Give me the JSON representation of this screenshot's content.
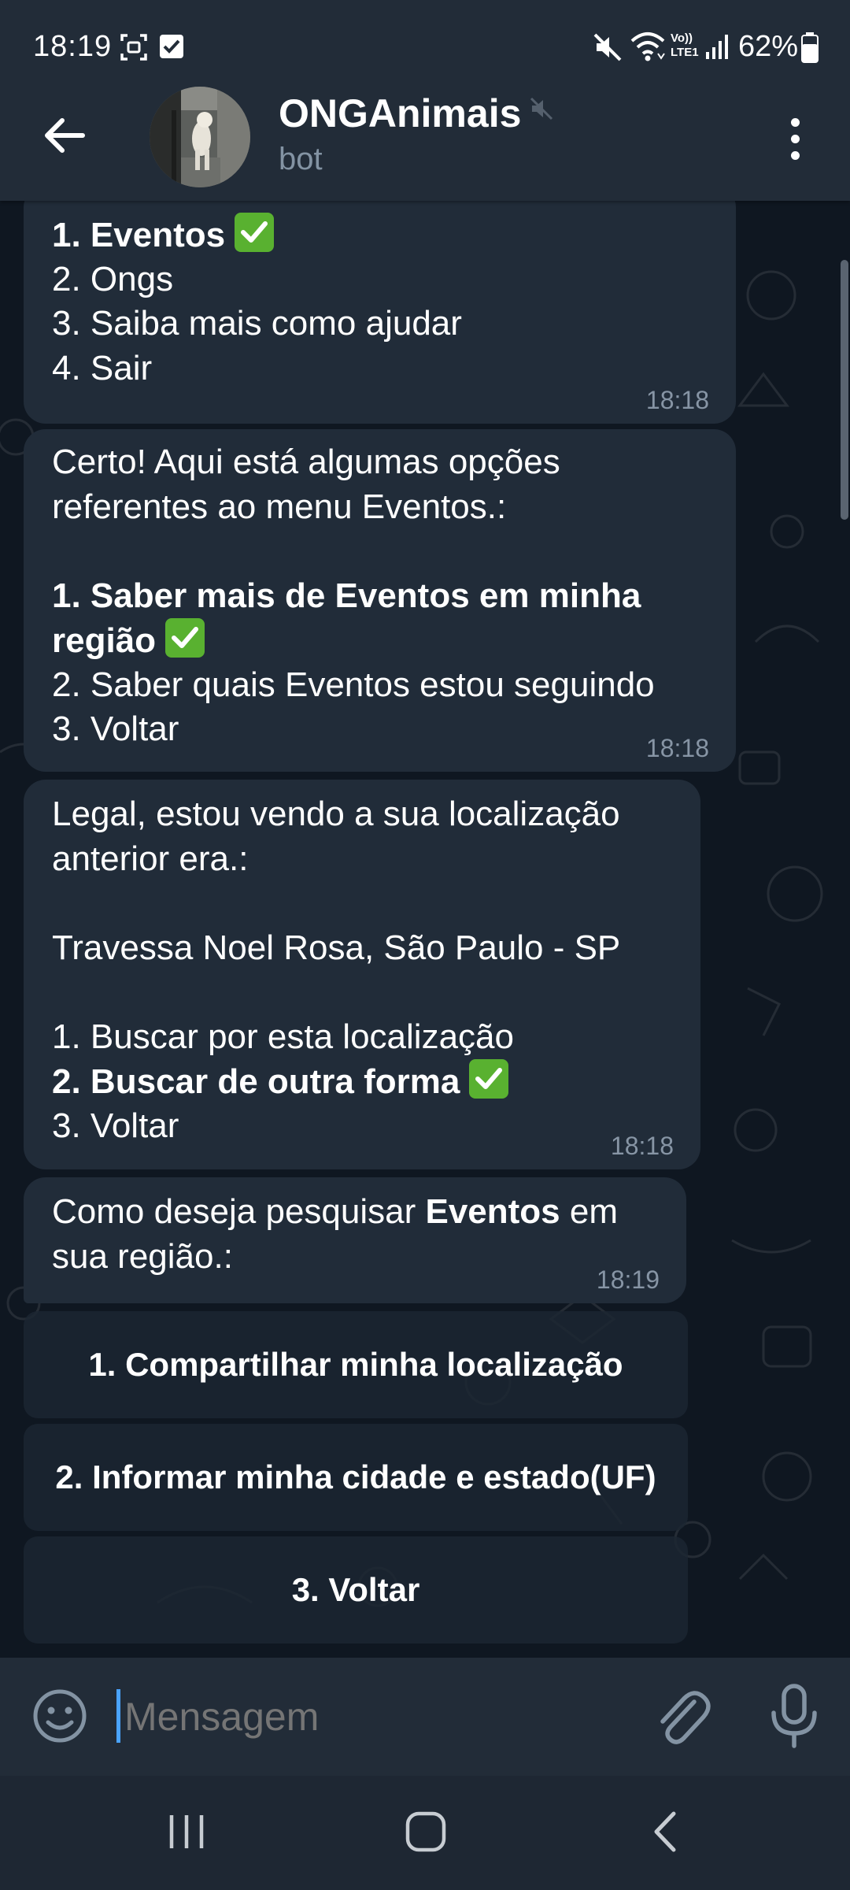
{
  "status_bar": {
    "time": "18:19",
    "battery": "62%",
    "icons": [
      "screenshot-icon",
      "checkbox-notification-icon",
      "mute-icon",
      "wifi-icon",
      "volte-icon",
      "signal-icon",
      "battery-icon"
    ],
    "volte_line1": "Vo))",
    "volte_line2": "LTE1"
  },
  "header": {
    "title": "ONGAnimais",
    "subtitle": "bot",
    "icons": [
      "back-arrow-icon",
      "mute-icon",
      "more-vert-icon"
    ]
  },
  "messages": [
    {
      "lines": [
        {
          "text": "1. Eventos",
          "bold": true,
          "check": true
        },
        {
          "text": "2. Ongs"
        },
        {
          "text": "3. Saiba mais como ajudar"
        },
        {
          "text": "4. Sair"
        }
      ],
      "time": "18:18"
    },
    {
      "lines": [
        {
          "text": "Certo! Aqui está algumas opções"
        },
        {
          "text": "referentes ao menu Eventos.:"
        },
        {
          "text": ""
        },
        {
          "text": "1. Saber mais de Eventos em minha",
          "bold": true
        },
        {
          "text": "região",
          "bold": true,
          "check": true
        },
        {
          "text": "2. Saber quais Eventos estou seguindo"
        },
        {
          "text": "3. Voltar"
        }
      ],
      "time": "18:18"
    },
    {
      "lines": [
        {
          "text": "Legal, estou vendo a sua localização"
        },
        {
          "text": "anterior era.:"
        },
        {
          "text": ""
        },
        {
          "text": "Travessa Noel Rosa, São Paulo - SP"
        },
        {
          "text": ""
        },
        {
          "text": "1. Buscar por esta localização"
        },
        {
          "text": "2. Buscar de outra forma",
          "bold": true,
          "check": true
        },
        {
          "text": "3. Voltar"
        }
      ],
      "time": "18:18"
    },
    {
      "line1_before": "Como deseja pesquisar ",
      "line1_bold": "Eventos",
      "line1_after": " em",
      "line2": "sua região.:",
      "time": "18:19"
    }
  ],
  "keyboard_buttons": [
    "1. Compartilhar minha localização",
    "2. Informar minha cidade e estado(UF)",
    "3. Voltar"
  ],
  "input": {
    "placeholder": "Mensagem",
    "icons": [
      "emoji-icon",
      "attach-icon",
      "microphone-icon"
    ]
  },
  "nav": {
    "icons": [
      "recent-apps-icon",
      "home-icon",
      "back-icon"
    ]
  },
  "colors": {
    "header_bg": "#222c38",
    "chat_bg": "#0f1721",
    "bubble_bg": "#212c39",
    "time_text": "#8795a5",
    "accent_cursor": "#4aa3ff",
    "check_emoji": "#59b130"
  }
}
